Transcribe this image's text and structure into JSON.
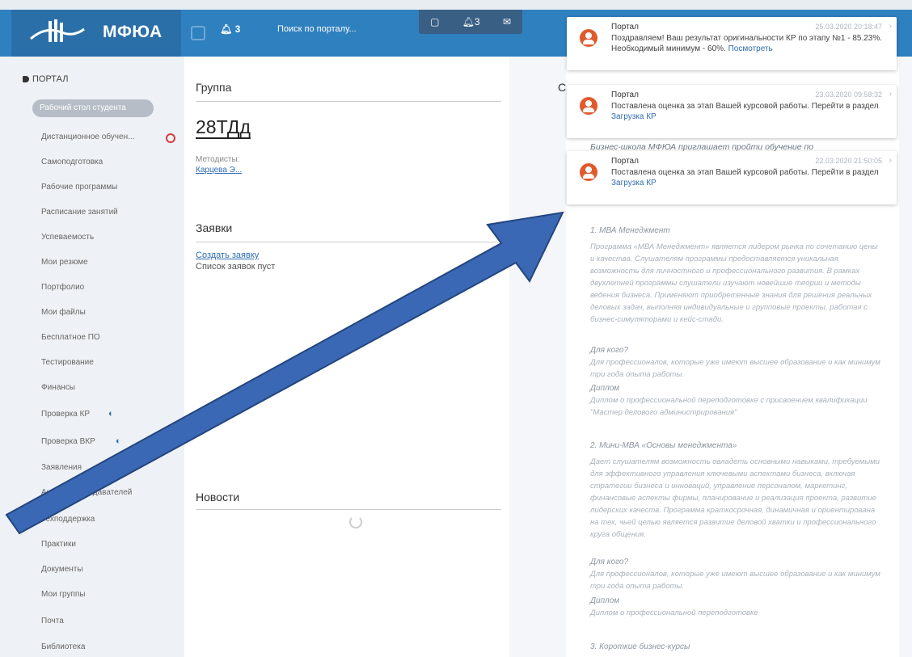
{
  "header": {
    "logo_text": "МФЮА",
    "bell_count": "3",
    "search_label": "Поиск по порталу...",
    "tools_bell_count": "3",
    "brand_color": "#2f80bf"
  },
  "sidebar": {
    "title": "ПОРТАЛ",
    "active_item": "Рабочий стол студента",
    "items": [
      "Дистанционное обучен...",
      "Самоподготовка",
      "Рабочие программы",
      "Расписание занятий",
      "Успеваемость",
      "Мои резюме",
      "Портфолио",
      "Мои файлы",
      "Бесплатное ПО",
      "Тестирование",
      "Финансы",
      "Проверка КР",
      "Проверка ВКР",
      "Заявления",
      "Анкеты преподавателей",
      "Техподдержка",
      "Практики",
      "Документы",
      "Мои группы",
      "Почта",
      "Библиотека"
    ]
  },
  "main": {
    "group_title": "Группа",
    "group_code": "28ТДд",
    "methodists_label": "Методисты:",
    "methodist_name": "Карцева Э...",
    "requests_title": "Заявки",
    "create_request": "Создать заявку",
    "requests_empty": "Список заявок пуст",
    "news_title": "Новости"
  },
  "right": {
    "tab_fragment": "С",
    "intro": "Бизнес-школа МФЮА приглашает пройти обучение по",
    "sections": [
      {
        "title": "1. МВА Менеджмент",
        "text": "Программа «МВА Менеджмент» является лидером рынка по сочетанию цены и качества. Слушателям программы предоставляется уникальная возможность для личностного и профессионального развития. В рамках двухлетней программы слушатели изучают новейшие теории и методы ведения бизнеса. Применяют приобретенные знания для решения реальных деловых задач, выполняя индивидуальные и групповые проекты, работая с бизнес-симуляторами и кейс-стади.",
        "who_label": "Для кого?",
        "who_text": "Для профессионалов, которые уже имеют высшее образование и как минимум три года опыта работы.",
        "diploma_label": "Диплом",
        "diploma_text": "Диплом о профессиональной переподготовке с присвоением квалификации \"Мастер делового администрирования\""
      },
      {
        "title": "2. Мини-МВА «Основы менеджмента»",
        "text": "Дает слушателям возможность овладеть основными навыками, требуемыми для эффективного управления ключевыми аспектами бизнеса, включая стратегии бизнеса и инноваций, управление персоналом, маркетинг, финансовые аспекты фирмы, планирование и реализация проекта, развитие лидерских качеств. Программа краткосрочная, динамичная и ориентирована на тех, чьей целью является развитие деловой хватки и профессионального круга общения.",
        "who_label": "Для кого?",
        "who_text": "Для профессионалов, которые уже имеют высшее образование и как минимум три года опыта работы.",
        "diploma_label": "Диплом",
        "diploma_text": "Диплом о профессиональной переподготовке"
      }
    ],
    "third_title": "3. Короткие бизнес-курсы"
  },
  "notifications": [
    {
      "title": "Портал",
      "date": "25.03.2020 20:18:47",
      "text": "Поздравляем! Ваш результат оригинальности КР по этапу №1 - 85.23%. Необходимый минимум - 60%.",
      "link": "Посмотреть"
    },
    {
      "title": "Портал",
      "date": "23.03.2020 09:58:32",
      "text": "Поставлена оценка за этап Вашей курсовой работы. Перейти в раздел",
      "link": "Загрузка КР"
    },
    {
      "title": "Портал",
      "date": "22.03.2020 21:50:05",
      "text": "Поставлена оценка за этап Вашей курсовой работы. Перейти в раздел",
      "link": "Загрузка КР"
    }
  ],
  "colors": {
    "accent": "#2f80bf",
    "arrow": "#3a68b4",
    "notif_avatar": "#e05a2c"
  }
}
